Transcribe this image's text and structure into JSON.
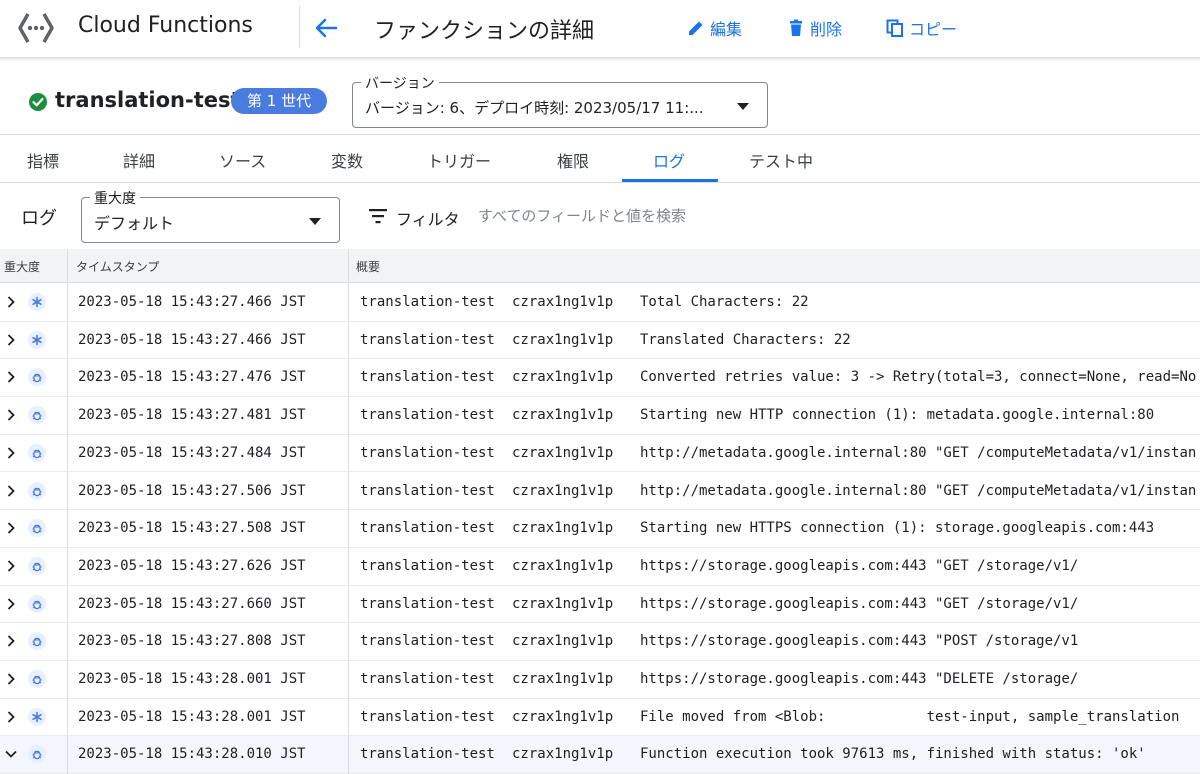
{
  "header": {
    "product_name": "Cloud Functions",
    "page_title": "ファンクションの詳細",
    "actions": {
      "edit": "編集",
      "delete": "削除",
      "copy": "コピー"
    }
  },
  "function": {
    "name": "translation-test",
    "status": "ok",
    "generation_badge": "第 1 世代",
    "version_label": "バージョン",
    "version_value": "バージョン: 6、デプロイ時刻: 2023/05/17 11:..."
  },
  "tabs": [
    {
      "label": "指標"
    },
    {
      "label": "詳細"
    },
    {
      "label": "ソース"
    },
    {
      "label": "変数"
    },
    {
      "label": "トリガー"
    },
    {
      "label": "権限"
    },
    {
      "label": "ログ",
      "active": true
    },
    {
      "label": "テスト中"
    }
  ],
  "logs_toolbar": {
    "title": "ログ",
    "severity_label": "重大度",
    "severity_value": "デフォルト",
    "filter_label": "フィルタ",
    "filter_placeholder": "すべてのフィールドと値を検索"
  },
  "log_table": {
    "columns": [
      "重大度",
      "タイムスタンプ",
      "概要"
    ],
    "rows": [
      {
        "severity": "default",
        "timestamp": "2023-05-18 15:43:27.466 JST",
        "function": "translation-test",
        "execution_id": "czrax1ng1v1p",
        "summary": "Total Characters: 22"
      },
      {
        "severity": "default",
        "timestamp": "2023-05-18 15:43:27.466 JST",
        "function": "translation-test",
        "execution_id": "czrax1ng1v1p",
        "summary": "Translated Characters: 22"
      },
      {
        "severity": "debug",
        "timestamp": "2023-05-18 15:43:27.476 JST",
        "function": "translation-test",
        "execution_id": "czrax1ng1v1p",
        "summary": "Converted retries value: 3 -> Retry(total=3, connect=None, read=No"
      },
      {
        "severity": "debug",
        "timestamp": "2023-05-18 15:43:27.481 JST",
        "function": "translation-test",
        "execution_id": "czrax1ng1v1p",
        "summary": "Starting new HTTP connection (1): metadata.google.internal:80"
      },
      {
        "severity": "debug",
        "timestamp": "2023-05-18 15:43:27.484 JST",
        "function": "translation-test",
        "execution_id": "czrax1ng1v1p",
        "summary": "http://metadata.google.internal:80 \"GET /computeMetadata/v1/instan"
      },
      {
        "severity": "debug",
        "timestamp": "2023-05-18 15:43:27.506 JST",
        "function": "translation-test",
        "execution_id": "czrax1ng1v1p",
        "summary": "http://metadata.google.internal:80 \"GET /computeMetadata/v1/instan"
      },
      {
        "severity": "debug",
        "timestamp": "2023-05-18 15:43:27.508 JST",
        "function": "translation-test",
        "execution_id": "czrax1ng1v1p",
        "summary": "Starting new HTTPS connection (1): storage.googleapis.com:443"
      },
      {
        "severity": "debug",
        "timestamp": "2023-05-18 15:43:27.626 JST",
        "function": "translation-test",
        "execution_id": "czrax1ng1v1p",
        "summary": "https://storage.googleapis.com:443 \"GET /storage/v1/"
      },
      {
        "severity": "debug",
        "timestamp": "2023-05-18 15:43:27.660 JST",
        "function": "translation-test",
        "execution_id": "czrax1ng1v1p",
        "summary": "https://storage.googleapis.com:443 \"GET /storage/v1/"
      },
      {
        "severity": "debug",
        "timestamp": "2023-05-18 15:43:27.808 JST",
        "function": "translation-test",
        "execution_id": "czrax1ng1v1p",
        "summary": "https://storage.googleapis.com:443 \"POST /storage/v1"
      },
      {
        "severity": "debug",
        "timestamp": "2023-05-18 15:43:28.001 JST",
        "function": "translation-test",
        "execution_id": "czrax1ng1v1p",
        "summary": "https://storage.googleapis.com:443 \"DELETE /storage/"
      },
      {
        "severity": "default",
        "timestamp": "2023-05-18 15:43:28.001 JST",
        "function": "translation-test",
        "execution_id": "czrax1ng1v1p",
        "summary": "File moved from <Blob:            test-input, sample_translation"
      },
      {
        "severity": "debug",
        "timestamp": "2023-05-18 15:43:28.010 JST",
        "function": "translation-test",
        "execution_id": "czrax1ng1v1p",
        "summary": "Function execution took 97613 ms, finished with status: 'ok'",
        "expanded": true
      }
    ]
  },
  "colors": {
    "accent": "#1a73e8",
    "badge": "#4a7ce0",
    "status_ok": "#1e8e3e",
    "severity_icon": "#4a7ce0",
    "header_bg": "#f1f3f4"
  },
  "icons": {
    "logo": "cloud-functions-logo-icon",
    "back": "arrow-left-icon",
    "edit": "pencil-icon",
    "delete": "trash-icon",
    "copy": "copy-icon",
    "status": "check-circle-icon",
    "filter": "filter-icon",
    "row_collapsed": "chevron-right-icon",
    "row_expanded": "chevron-down-icon",
    "severity_default": "asterisk-icon",
    "severity_debug": "bug-icon"
  }
}
